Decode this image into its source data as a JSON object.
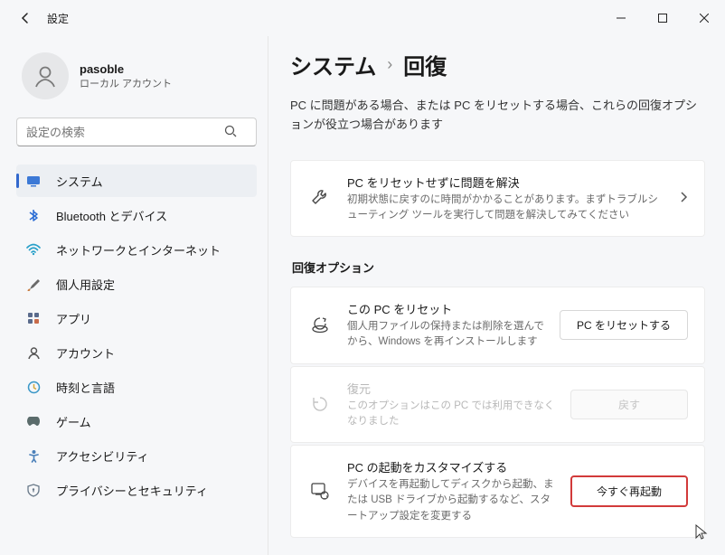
{
  "titlebar": {
    "title": "設定"
  },
  "user": {
    "name": "pasoble",
    "sub": "ローカル アカウント"
  },
  "search": {
    "placeholder": "設定の検索"
  },
  "nav": [
    {
      "label": "システム"
    },
    {
      "label": "Bluetooth とデバイス"
    },
    {
      "label": "ネットワークとインターネット"
    },
    {
      "label": "個人用設定"
    },
    {
      "label": "アプリ"
    },
    {
      "label": "アカウント"
    },
    {
      "label": "時刻と言語"
    },
    {
      "label": "ゲーム"
    },
    {
      "label": "アクセシビリティ"
    },
    {
      "label": "プライバシーとセキュリティ"
    }
  ],
  "breadcrumb": {
    "parent": "システム",
    "current": "回復"
  },
  "intro": "PC に問題がある場合、または PC をリセットする場合、これらの回復オプションが役立つ場合があります",
  "troubleshoot": {
    "title": "PC をリセットせずに問題を解決",
    "desc": "初期状態に戻すのに時間がかかることがあります。まずトラブルシューティング ツールを実行して問題を解決してみてください"
  },
  "section_label": "回復オプション",
  "reset": {
    "title": "この PC をリセット",
    "desc": "個人用ファイルの保持または削除を選んでから、Windows を再インストールします",
    "button": "PC をリセットする"
  },
  "restore": {
    "title": "復元",
    "desc": "このオプションはこの PC では利用できなくなりました",
    "button": "戻す"
  },
  "customboot": {
    "title": "PC の起動をカスタマイズする",
    "desc": "デバイスを再起動してディスクから起動、または USB ドライブから起動するなど、スタートアップ設定を変更する",
    "button": "今すぐ再起動"
  }
}
